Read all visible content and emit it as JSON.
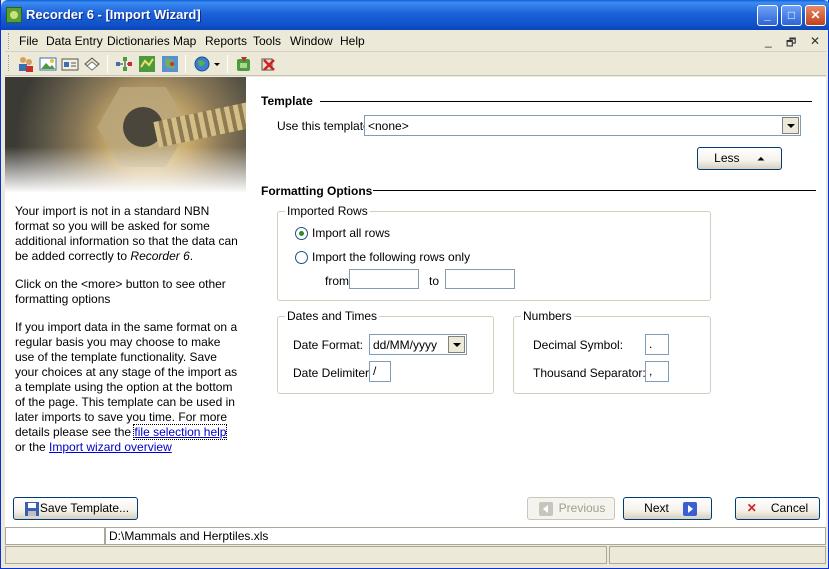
{
  "window": {
    "title": "Recorder 6 - [Import Wizard]",
    "minimize": "_",
    "maximize": "□",
    "close": "✕"
  },
  "menu": {
    "items": [
      "File",
      "Data Entry",
      "Dictionaries",
      "Map",
      "Reports",
      "Tools",
      "Window",
      "Help"
    ],
    "mdi_min": "_",
    "mdi_restore": "🗗",
    "mdi_close": "✕"
  },
  "sidebar": {
    "para1_a": "Your import is not in a standard NBN format so you will be asked for some additional information so that the data can be added correctly to ",
    "para1_app": "Recorder 6",
    "para1_b": ".",
    "para2": "Click on the <more> button to see other formatting options",
    "para3": "If you import data in the same format on a regular basis you may choose to make use of the template functionality. Save your choices at any stage of the import as a template using the option at the bottom of the page. This template can be used in later imports to save you time. For more details please see the ",
    "link1": "file selection help",
    "or_text": " or the ",
    "link2": "Import wizard overview"
  },
  "template": {
    "section_title": "Template",
    "use_label": "Use this template:",
    "selected": "<none>",
    "less_button": "Less"
  },
  "formatting": {
    "section_title": "Formatting Options",
    "rows": {
      "group_label": "Imported Rows",
      "all_rows": "Import all rows",
      "following_rows": "Import the following rows only",
      "from_label": "from",
      "to_label": "to",
      "from_value": "",
      "to_value": "",
      "selected": "all_rows"
    },
    "dates": {
      "group_label": "Dates and Times",
      "date_format_label": "Date Format:",
      "date_format_value": "dd/MM/yyyy",
      "date_delimiter_label": "Date Delimiter:",
      "date_delimiter_value": "/"
    },
    "numbers": {
      "group_label": "Numbers",
      "decimal_label": "Decimal Symbol:",
      "decimal_value": ".",
      "thousand_label": "Thousand Separator:",
      "thousand_value": ","
    }
  },
  "footer": {
    "save_template": "Save Template...",
    "previous": "Previous",
    "next": "Next",
    "cancel": "Cancel"
  },
  "status": {
    "file_path": "D:\\Mammals and Herptiles.xls"
  },
  "colors": {
    "titlebar": "#0F50C8",
    "link": "#0000CC",
    "cancel_icon": "#D02020",
    "next_icon": "#3A5FD0"
  }
}
